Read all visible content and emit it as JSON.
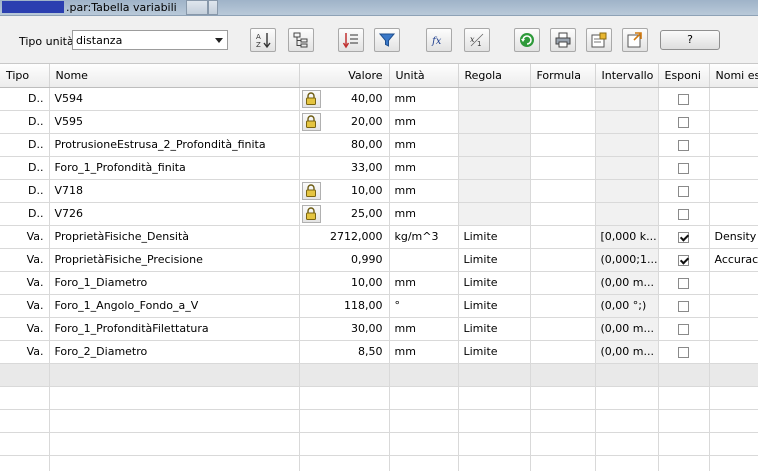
{
  "window": {
    "title": ".par:Tabella variabili"
  },
  "toolbar": {
    "tipo_unita_label": "Tipo unità:",
    "tipo_unita_value": "distanza",
    "help_label": "?"
  },
  "table": {
    "headers": [
      "Tipo",
      "Nome",
      "Valore",
      "Unità",
      "Regola",
      "Formula",
      "Intervallo",
      "Esponi",
      "Nomi es"
    ],
    "rows": [
      {
        "tipo": "D..",
        "nome": "V594",
        "valore": "40,00",
        "unita": "mm",
        "regola": "",
        "formula": "",
        "intervallo": "",
        "esponi": false,
        "nomi": "",
        "locked": true
      },
      {
        "tipo": "D..",
        "nome": "V595",
        "valore": "20,00",
        "unita": "mm",
        "regola": "",
        "formula": "",
        "intervallo": "",
        "esponi": false,
        "nomi": "",
        "locked": true
      },
      {
        "tipo": "D..",
        "nome": "ProtrusioneEstrusa_2_Profondità_finita",
        "valore": "80,00",
        "unita": "mm",
        "regola": "",
        "formula": "",
        "intervallo": "",
        "esponi": false,
        "nomi": "",
        "locked": false
      },
      {
        "tipo": "D..",
        "nome": "Foro_1_Profondità_finita",
        "valore": "33,00",
        "unita": "mm",
        "regola": "",
        "formula": "",
        "intervallo": "",
        "esponi": false,
        "nomi": "",
        "locked": false
      },
      {
        "tipo": "D..",
        "nome": "V718",
        "valore": "10,00",
        "unita": "mm",
        "regola": "",
        "formula": "",
        "intervallo": "",
        "esponi": false,
        "nomi": "",
        "locked": true
      },
      {
        "tipo": "D..",
        "nome": "V726",
        "valore": "25,00",
        "unita": "mm",
        "regola": "",
        "formula": "",
        "intervallo": "",
        "esponi": false,
        "nomi": "",
        "locked": true
      },
      {
        "tipo": "Va.",
        "nome": "ProprietàFisiche_Densità",
        "valore": "2712,000",
        "unita": "kg/m^3",
        "regola": "Limite",
        "formula": "",
        "intervallo": "[0,000 k...",
        "esponi": true,
        "nomi": "Density",
        "locked": false
      },
      {
        "tipo": "Va.",
        "nome": "ProprietàFisiche_Precisione",
        "valore": "0,990",
        "unita": "",
        "regola": "Limite",
        "formula": "",
        "intervallo": "(0,000;1....",
        "esponi": true,
        "nomi": "Accurac",
        "locked": false
      },
      {
        "tipo": "Va.",
        "nome": "Foro_1_Diametro",
        "valore": "10,00",
        "unita": "mm",
        "regola": "Limite",
        "formula": "",
        "intervallo": "(0,00 m...",
        "esponi": false,
        "nomi": "",
        "locked": false
      },
      {
        "tipo": "Va.",
        "nome": "Foro_1_Angolo_Fondo_a_V",
        "valore": "118,00",
        "unita": "°",
        "regola": "Limite",
        "formula": "",
        "intervallo": "(0,00 °;)",
        "esponi": false,
        "nomi": "",
        "locked": false
      },
      {
        "tipo": "Va.",
        "nome": "Foro_1_ProfonditàFilettatura",
        "valore": "30,00",
        "unita": "mm",
        "regola": "Limite",
        "formula": "",
        "intervallo": "(0,00 m...",
        "esponi": false,
        "nomi": "",
        "locked": false
      },
      {
        "tipo": "Va.",
        "nome": "Foro_2_Diametro",
        "valore": "8,50",
        "unita": "mm",
        "regola": "Limite",
        "formula": "",
        "intervallo": "(0,00 m...",
        "esponi": false,
        "nomi": "",
        "locked": false
      }
    ]
  },
  "icons": [
    "sort-az-icon",
    "tree-icon",
    "sort-list-icon",
    "filter-icon",
    "fx-icon",
    "fx-var-icon",
    "refresh-icon",
    "print-icon",
    "import-icon",
    "export-icon",
    "lock-icon"
  ],
  "colors": {
    "title_redaction": "#2b3fb0",
    "grid_gray_cell": "#f1f1f1",
    "filter_blue": "#3a78c8",
    "refresh_green": "#2e9a3a"
  }
}
